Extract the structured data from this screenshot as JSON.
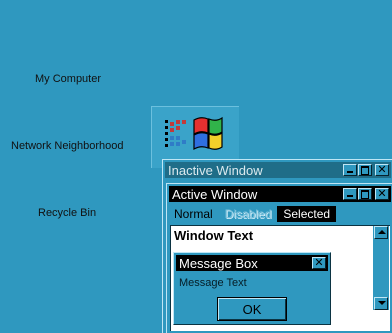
{
  "desktop": {
    "icons": [
      {
        "label": "My Computer"
      },
      {
        "label": "Network Neighborhood"
      },
      {
        "label": "Recycle Bin"
      }
    ]
  },
  "inactive_window": {
    "title": "Inactive Window"
  },
  "active_window": {
    "title": "Active Window",
    "menu": {
      "normal": "Normal",
      "disabled": "Disabled",
      "selected": "Selected"
    },
    "window_text": "Window Text"
  },
  "message_box": {
    "title": "Message Box",
    "text": "Message Text",
    "ok_label": "OK"
  },
  "colors": {
    "desktop": "#2f98bf",
    "active_title": "#000000",
    "inactive_title": "#1f6d88",
    "window_bg": "#ffffff"
  }
}
